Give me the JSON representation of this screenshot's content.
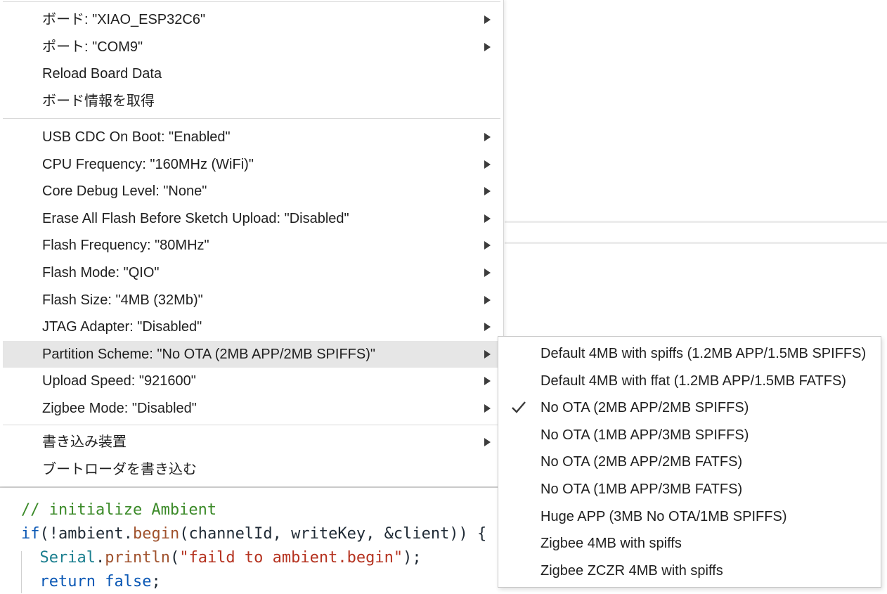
{
  "menu": {
    "groups": [
      [
        {
          "label": "ボード: \"XIAO_ESP32C6\"",
          "submenu": true
        },
        {
          "label": "ポート: \"COM9\"",
          "submenu": true
        },
        {
          "label": "Reload Board Data",
          "submenu": false
        },
        {
          "label": "ボード情報を取得",
          "submenu": false
        }
      ],
      [
        {
          "label": "USB CDC On Boot: \"Enabled\"",
          "submenu": true
        },
        {
          "label": "CPU Frequency: \"160MHz (WiFi)\"",
          "submenu": true
        },
        {
          "label": "Core Debug Level: \"None\"",
          "submenu": true
        },
        {
          "label": "Erase All Flash Before Sketch Upload: \"Disabled\"",
          "submenu": true
        },
        {
          "label": "Flash Frequency: \"80MHz\"",
          "submenu": true
        },
        {
          "label": "Flash Mode: \"QIO\"",
          "submenu": true
        },
        {
          "label": "Flash Size: \"4MB (32Mb)\"",
          "submenu": true
        },
        {
          "label": "JTAG Adapter: \"Disabled\"",
          "submenu": true
        },
        {
          "label": "Partition Scheme: \"No OTA (2MB APP/2MB SPIFFS)\"",
          "submenu": true,
          "active": true
        },
        {
          "label": "Upload Speed: \"921600\"",
          "submenu": true
        },
        {
          "label": "Zigbee Mode: \"Disabled\"",
          "submenu": true
        }
      ],
      [
        {
          "label": "書き込み装置",
          "submenu": true
        },
        {
          "label": "ブートローダを書き込む",
          "submenu": false
        }
      ]
    ]
  },
  "submenu": {
    "items": [
      {
        "label": "Default 4MB with spiffs (1.2MB APP/1.5MB SPIFFS)",
        "checked": false
      },
      {
        "label": "Default 4MB with ffat (1.2MB APP/1.5MB FATFS)",
        "checked": false
      },
      {
        "label": "No OTA (2MB APP/2MB SPIFFS)",
        "checked": true
      },
      {
        "label": "No OTA (1MB APP/3MB SPIFFS)",
        "checked": false
      },
      {
        "label": "No OTA (2MB APP/2MB FATFS)",
        "checked": false
      },
      {
        "label": "No OTA (1MB APP/3MB FATFS)",
        "checked": false
      },
      {
        "label": "Huge APP (3MB No OTA/1MB SPIFFS)",
        "checked": false
      },
      {
        "label": "Zigbee 4MB with spiffs",
        "checked": false
      },
      {
        "label": "Zigbee ZCZR 4MB with spiffs",
        "checked": false
      }
    ]
  },
  "editor": {
    "lines": [
      [
        {
          "t": "// initialize Ambient",
          "c": "comment"
        }
      ],
      [
        {
          "t": "if",
          "c": "kw"
        },
        {
          "t": "(!",
          "c": "plain"
        },
        {
          "t": "ambient",
          "c": "plain"
        },
        {
          "t": ".",
          "c": "plain"
        },
        {
          "t": "begin",
          "c": "fn"
        },
        {
          "t": "(channelId, writeKey, &client)) {",
          "c": "plain"
        }
      ],
      [
        {
          "t": "  ",
          "c": "plain"
        },
        {
          "t": "Serial",
          "c": "class"
        },
        {
          "t": ".",
          "c": "plain"
        },
        {
          "t": "println",
          "c": "fn"
        },
        {
          "t": "(",
          "c": "plain"
        },
        {
          "t": "\"faild to ambient.begin\"",
          "c": "str"
        },
        {
          "t": ");",
          "c": "plain"
        }
      ],
      [
        {
          "t": "  ",
          "c": "plain"
        },
        {
          "t": "return",
          "c": "kw"
        },
        {
          "t": " ",
          "c": "plain"
        },
        {
          "t": "false",
          "c": "kw"
        },
        {
          "t": ";",
          "c": "plain"
        }
      ]
    ]
  },
  "colors": {
    "active_bg": "#e6e6e6",
    "comment": "#3b8a28",
    "keyword": "#0b58b5",
    "string": "#b5321f",
    "function": "#a0522d"
  }
}
